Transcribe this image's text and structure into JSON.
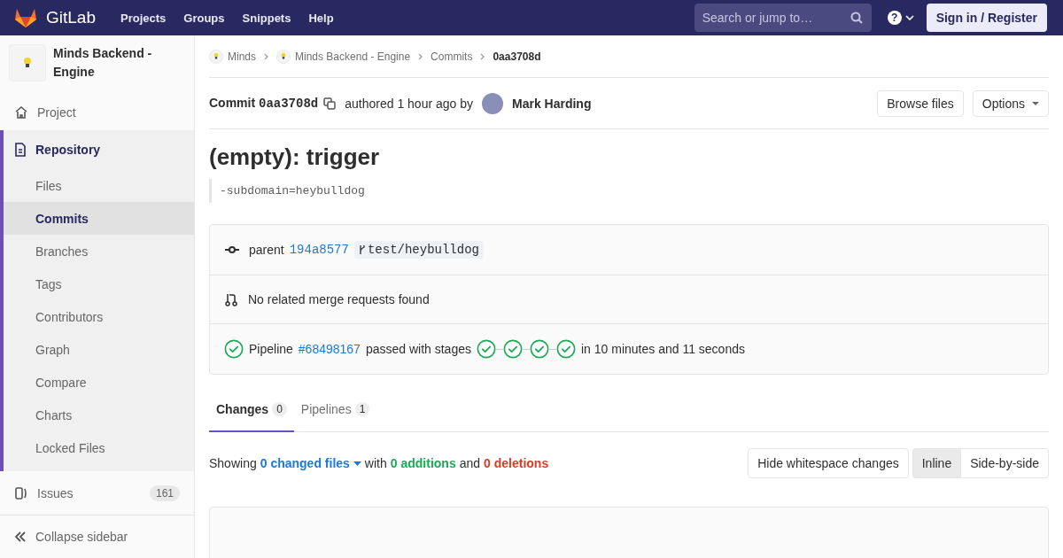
{
  "header": {
    "brand": "GitLab",
    "nav": [
      "Projects",
      "Groups",
      "Snippets",
      "Help"
    ],
    "search": {
      "placeholder": "Search or jump to…"
    },
    "help_icon": "?",
    "sign_in": "Sign in / Register"
  },
  "sidebar": {
    "project_name": "Minds Backend - Engine",
    "items": [
      {
        "kind": "home",
        "label": "Project",
        "selected": false
      },
      {
        "kind": "repo",
        "label": "Repository",
        "selected": true,
        "children": [
          {
            "label": "Files",
            "selected": false
          },
          {
            "label": "Commits",
            "selected": true
          },
          {
            "label": "Branches",
            "selected": false
          },
          {
            "label": "Tags",
            "selected": false
          },
          {
            "label": "Contributors",
            "selected": false
          },
          {
            "label": "Graph",
            "selected": false
          },
          {
            "label": "Compare",
            "selected": false
          },
          {
            "label": "Charts",
            "selected": false
          },
          {
            "label": "Locked Files",
            "selected": false
          }
        ]
      },
      {
        "kind": "issues",
        "label": "Issues",
        "count": "161",
        "selected": false
      }
    ],
    "collapse": "Collapse sidebar"
  },
  "breadcrumbs": [
    {
      "label": "Minds",
      "avatar": true
    },
    {
      "label": "Minds Backend - Engine",
      "avatar": true
    },
    {
      "label": "Commits",
      "avatar": false
    },
    {
      "label": "0aa3708d",
      "avatar": false
    }
  ],
  "commit": {
    "label": "Commit",
    "sha": "0aa3708d",
    "authored": "authored 1 hour ago by",
    "author": "Mark Harding",
    "buttons": [
      "Browse files",
      "Options"
    ]
  },
  "title": "(empty): trigger",
  "description": "-subdomain=heybulldog",
  "info": {
    "parent_label": "parent",
    "parent_sha": "194a8577",
    "branch": "test/heybulldog",
    "merge_text": "No related merge requests found",
    "pipeline": {
      "label": "Pipeline",
      "id": "#68498167",
      "text": "passed with stages",
      "stages": [
        {
          "passed": true
        },
        {
          "passed": true
        },
        {
          "passed": true
        },
        {
          "passed": true
        }
      ],
      "duration": "in 10 minutes and 11 seconds"
    }
  },
  "tabs": [
    {
      "label": "Changes",
      "count": "0",
      "selected": true
    },
    {
      "label": "Pipelines",
      "count": "1",
      "selected": false
    }
  ],
  "stats": {
    "showing": "Showing",
    "changed": "0 changed files",
    "with": "with",
    "additions": "0 additions",
    "and": "and",
    "deletions": "0 deletions"
  },
  "whitespace_button": "Hide whitespace changes",
  "view_modes": [
    {
      "label": "Inline",
      "selected": true
    },
    {
      "label": "Side-by-side",
      "selected": false
    }
  ]
}
